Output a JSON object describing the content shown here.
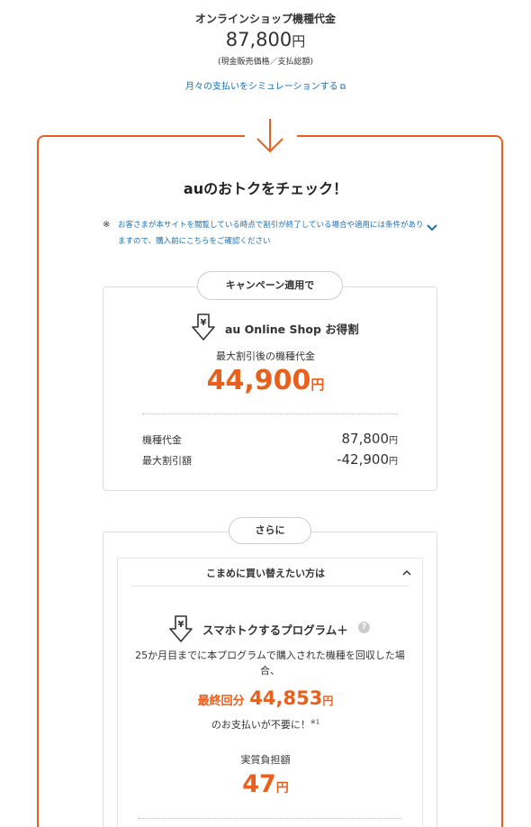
{
  "top": {
    "label": "オンラインショップ機種代金",
    "price": "87,800",
    "yen": "円",
    "note": "(現金販売価格／支払総額)",
    "simulation_link": "月々の支払いをシミュレーションする",
    "link_icon": "external-link-icon"
  },
  "colors": {
    "accent": "#e8601c",
    "link": "#1a6fb5"
  },
  "check": {
    "title": "auのおトクをチェック！",
    "note_mark": "※",
    "note_text": "お客さまが本サイトを閲覧している時点で割引が終了している場合や適用には条件がありますので、購入前にこちらをご確認ください"
  },
  "campaign": {
    "pill": "キャンペーン適用で",
    "deal_title": "au Online Shop お得割",
    "sub": "最大割引後の機種代金",
    "price": "44,900",
    "yen": "円",
    "rows": [
      {
        "label": "機種代金",
        "value": "87,800",
        "yen": "円"
      },
      {
        "label": "最大割引額",
        "value": "-42,900",
        "yen": "円"
      }
    ]
  },
  "further": {
    "pill": "さらに",
    "accordion_title": "こまめに買い替えたい方は",
    "program_title": "スマホトクするプログラム＋",
    "help": "?",
    "description": "25か月目までに本プログラムで購入された機種を回収した場合、",
    "final_label": "最終回分",
    "final_value": "44,853",
    "yen": "円",
    "not_needed": "のお支払いが不要に！",
    "not_needed_note": "※1",
    "burden_label": "実質負担額",
    "burden_value": "47"
  }
}
